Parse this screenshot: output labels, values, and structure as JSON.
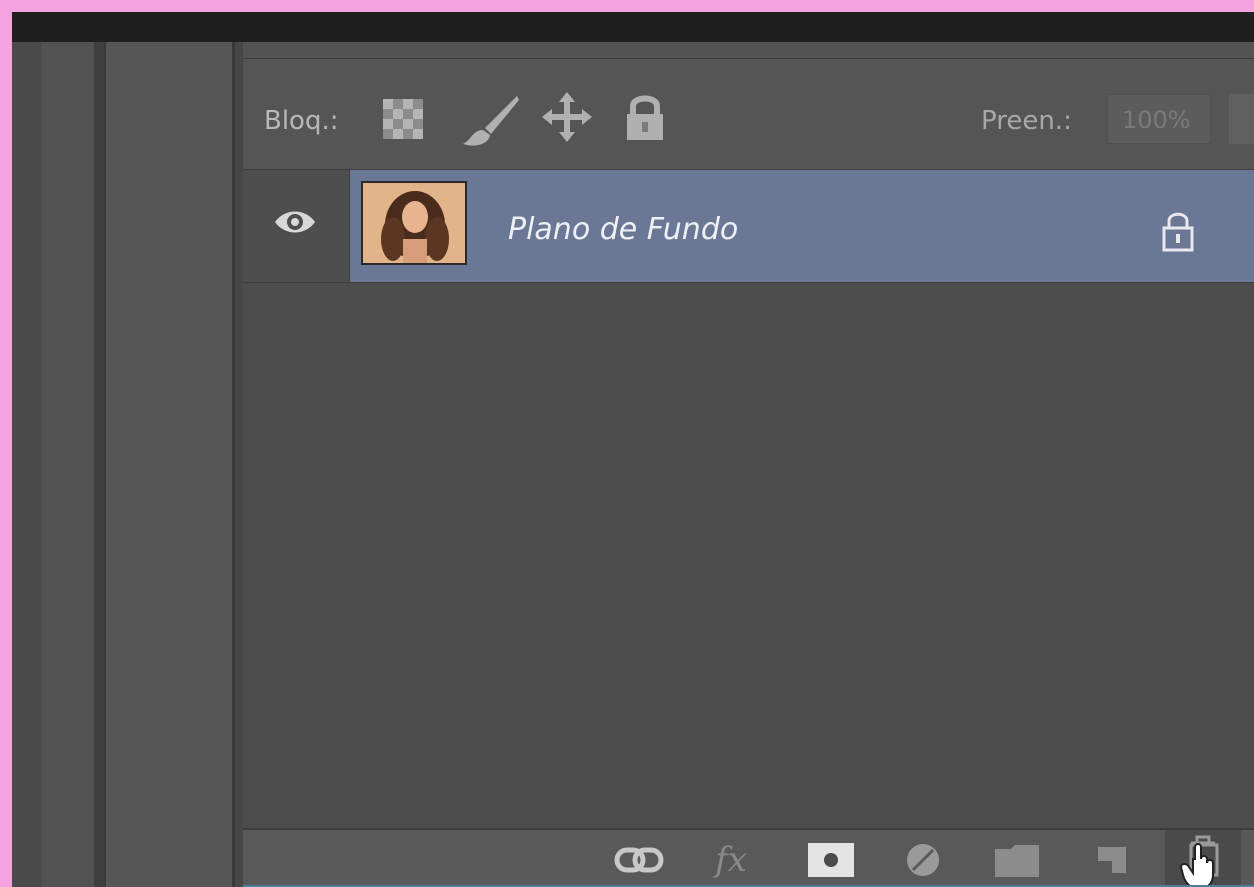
{
  "layers_panel": {
    "lock_label": "Bloq.:",
    "fill_label": "Preen.:",
    "fill_value": "100%",
    "layers": [
      {
        "name": "Plano de Fundo",
        "visible": true,
        "selected": true,
        "locked": true
      }
    ]
  },
  "colors": {
    "page_border": "#f5a3e0",
    "selected_layer": "#6a7896",
    "panel_bg": "#4d4d4d"
  },
  "icons": {
    "lock_transparent": "checkerboard-icon",
    "lock_pixels": "brush-icon",
    "lock_position": "move-icon",
    "lock_all": "lock-icon",
    "layer_visibility": "eye-icon",
    "layer_lock": "lock-icon",
    "bottom_bar": [
      "link-icon",
      "fx-icon",
      "mask-icon",
      "adjustment-icon",
      "folder-icon",
      "new-layer-icon",
      "trash-icon"
    ]
  }
}
